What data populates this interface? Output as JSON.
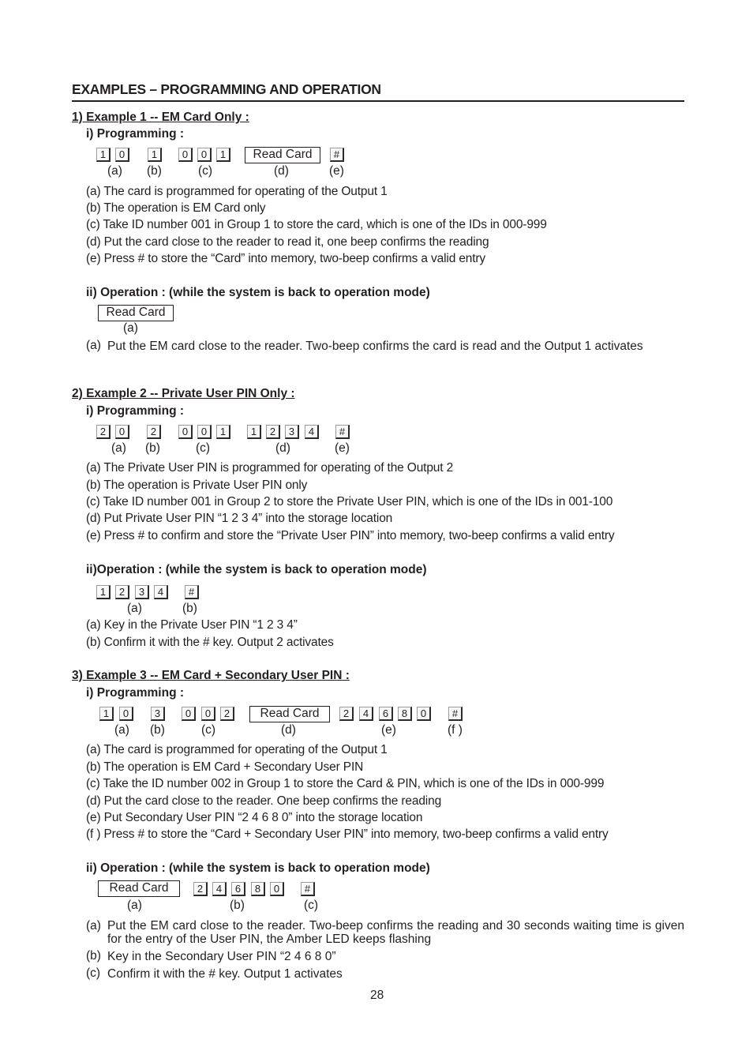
{
  "title": "EXAMPLES – PROGRAMMING AND OPERATION",
  "page_number": "28",
  "read_card_label": "Read Card",
  "examples": [
    {
      "heading": "1) Example 1 -- EM Card Only :",
      "programming": {
        "heading": "i) Programming :",
        "groups": [
          {
            "keys": [
              "1",
              "0"
            ],
            "label": "(a)"
          },
          {
            "keys": [
              "1"
            ],
            "label": "(b)"
          },
          {
            "keys": [
              "0",
              "0",
              "1"
            ],
            "label": "(c)"
          },
          {
            "card": "Read Card",
            "label": "(d)"
          },
          {
            "keys": [
              "#"
            ],
            "label": "(e)"
          }
        ],
        "notes": [
          "(a) The card is programmed for operating of the Output 1",
          "(b) The operation is EM Card only",
          "(c) Take ID number 001 in Group 1 to store the card, which is one of the IDs in 000-999",
          "(d) Put the card close to the reader to read it, one beep confirms the reading",
          "(e) Press # to store the “Card” into memory, two-beep confirms a valid entry"
        ]
      },
      "operation": {
        "heading": "ii) Operation : (while the system is back to operation mode)",
        "groups": [
          {
            "card": "Read Card",
            "label": "(a)"
          }
        ],
        "notes": [
          {
            "mark": "(a)",
            "text": "Put the EM card close to the reader. Two-beep confirms the card is read and the Output 1 activates"
          }
        ]
      }
    },
    {
      "heading": "2) Example 2 -- Private User PIN Only :",
      "programming": {
        "heading": "i) Programming :",
        "groups": [
          {
            "keys": [
              "2",
              "0"
            ],
            "label": "(a)"
          },
          {
            "keys": [
              "2"
            ],
            "label": "(b)"
          },
          {
            "keys": [
              "0",
              "0",
              "1"
            ],
            "label": "(c)"
          },
          {
            "keys": [
              "1",
              "2",
              "3",
              "4"
            ],
            "label": "(d)"
          },
          {
            "keys": [
              "#"
            ],
            "label": "(e)"
          }
        ],
        "notes": [
          "(a) The Private User PIN is programmed for operating of the Output 2",
          "(b) The operation is Private User PIN only",
          "(c) Take ID number 001 in Group 2 to store the Private User PIN, which is one of the IDs in 001-100",
          "(d) Put Private User PIN “1 2 3 4” into the storage location",
          "(e) Press # to confirm and store the “Private User PIN” into memory, two-beep confirms a valid entry"
        ]
      },
      "operation": {
        "heading": "ii)Operation : (while the system is back to operation mode)",
        "groups": [
          {
            "keys": [
              "1",
              "2",
              "3",
              "4"
            ],
            "label": "(a)"
          },
          {
            "keys": [
              "#"
            ],
            "label": "(b)"
          }
        ],
        "notes": [
          "(a) Key in the Private User PIN “1 2 3 4”",
          "(b) Confirm it with the # key. Output 2 activates"
        ]
      }
    },
    {
      "heading": "3) Example 3 -- EM Card + Secondary User PIN :",
      "programming": {
        "heading": "i)  Programming :",
        "groups": [
          {
            "keys": [
              "1",
              "0"
            ],
            "label": "(a)"
          },
          {
            "keys": [
              "3"
            ],
            "label": "(b)"
          },
          {
            "keys": [
              "0",
              "0",
              "2"
            ],
            "label": "(c)"
          },
          {
            "card": "Read Card",
            "label": "(d)"
          },
          {
            "keys": [
              "2",
              "4",
              "6",
              "8",
              "0"
            ],
            "label": "(e)"
          },
          {
            "keys": [
              "#"
            ],
            "label": "(f )"
          }
        ],
        "notes": [
          "(a) The card is programmed for operating of the Output 1",
          "(b) The operation is EM Card + Secondary User PIN",
          "(c) Take the ID number 002 in Group 1 to store the Card & PIN, which is one of the IDs in 000-999",
          "(d) Put the card close to the reader. One beep confirms the reading",
          "(e) Put Secondary User PIN “2 4 6 8 0” into the storage location",
          "(f ) Press # to store the “Card + Secondary User PIN” into memory, two-beep confirms a valid entry"
        ]
      },
      "operation": {
        "heading": "ii) Operation : (while the system is back to operation mode)",
        "groups": [
          {
            "card": "Read Card",
            "label": "(a)"
          },
          {
            "keys": [
              "2",
              "4",
              "6",
              "8",
              "0"
            ],
            "label": "(b)"
          },
          {
            "keys": [
              "#"
            ],
            "label": "(c)"
          }
        ],
        "notes": [
          {
            "mark": "(a)",
            "text": "Put the EM card close to the reader. Two-beep confirms the reading and 30 seconds waiting time is given for the entry of the User PIN, the Amber LED keeps flashing"
          },
          {
            "mark": "(b)",
            "text": "Key in the Secondary User PIN “2 4 6 8 0”"
          },
          {
            "mark": "(c)",
            "text": "Confirm it with the # key. Output 1 activates"
          }
        ]
      }
    }
  ]
}
